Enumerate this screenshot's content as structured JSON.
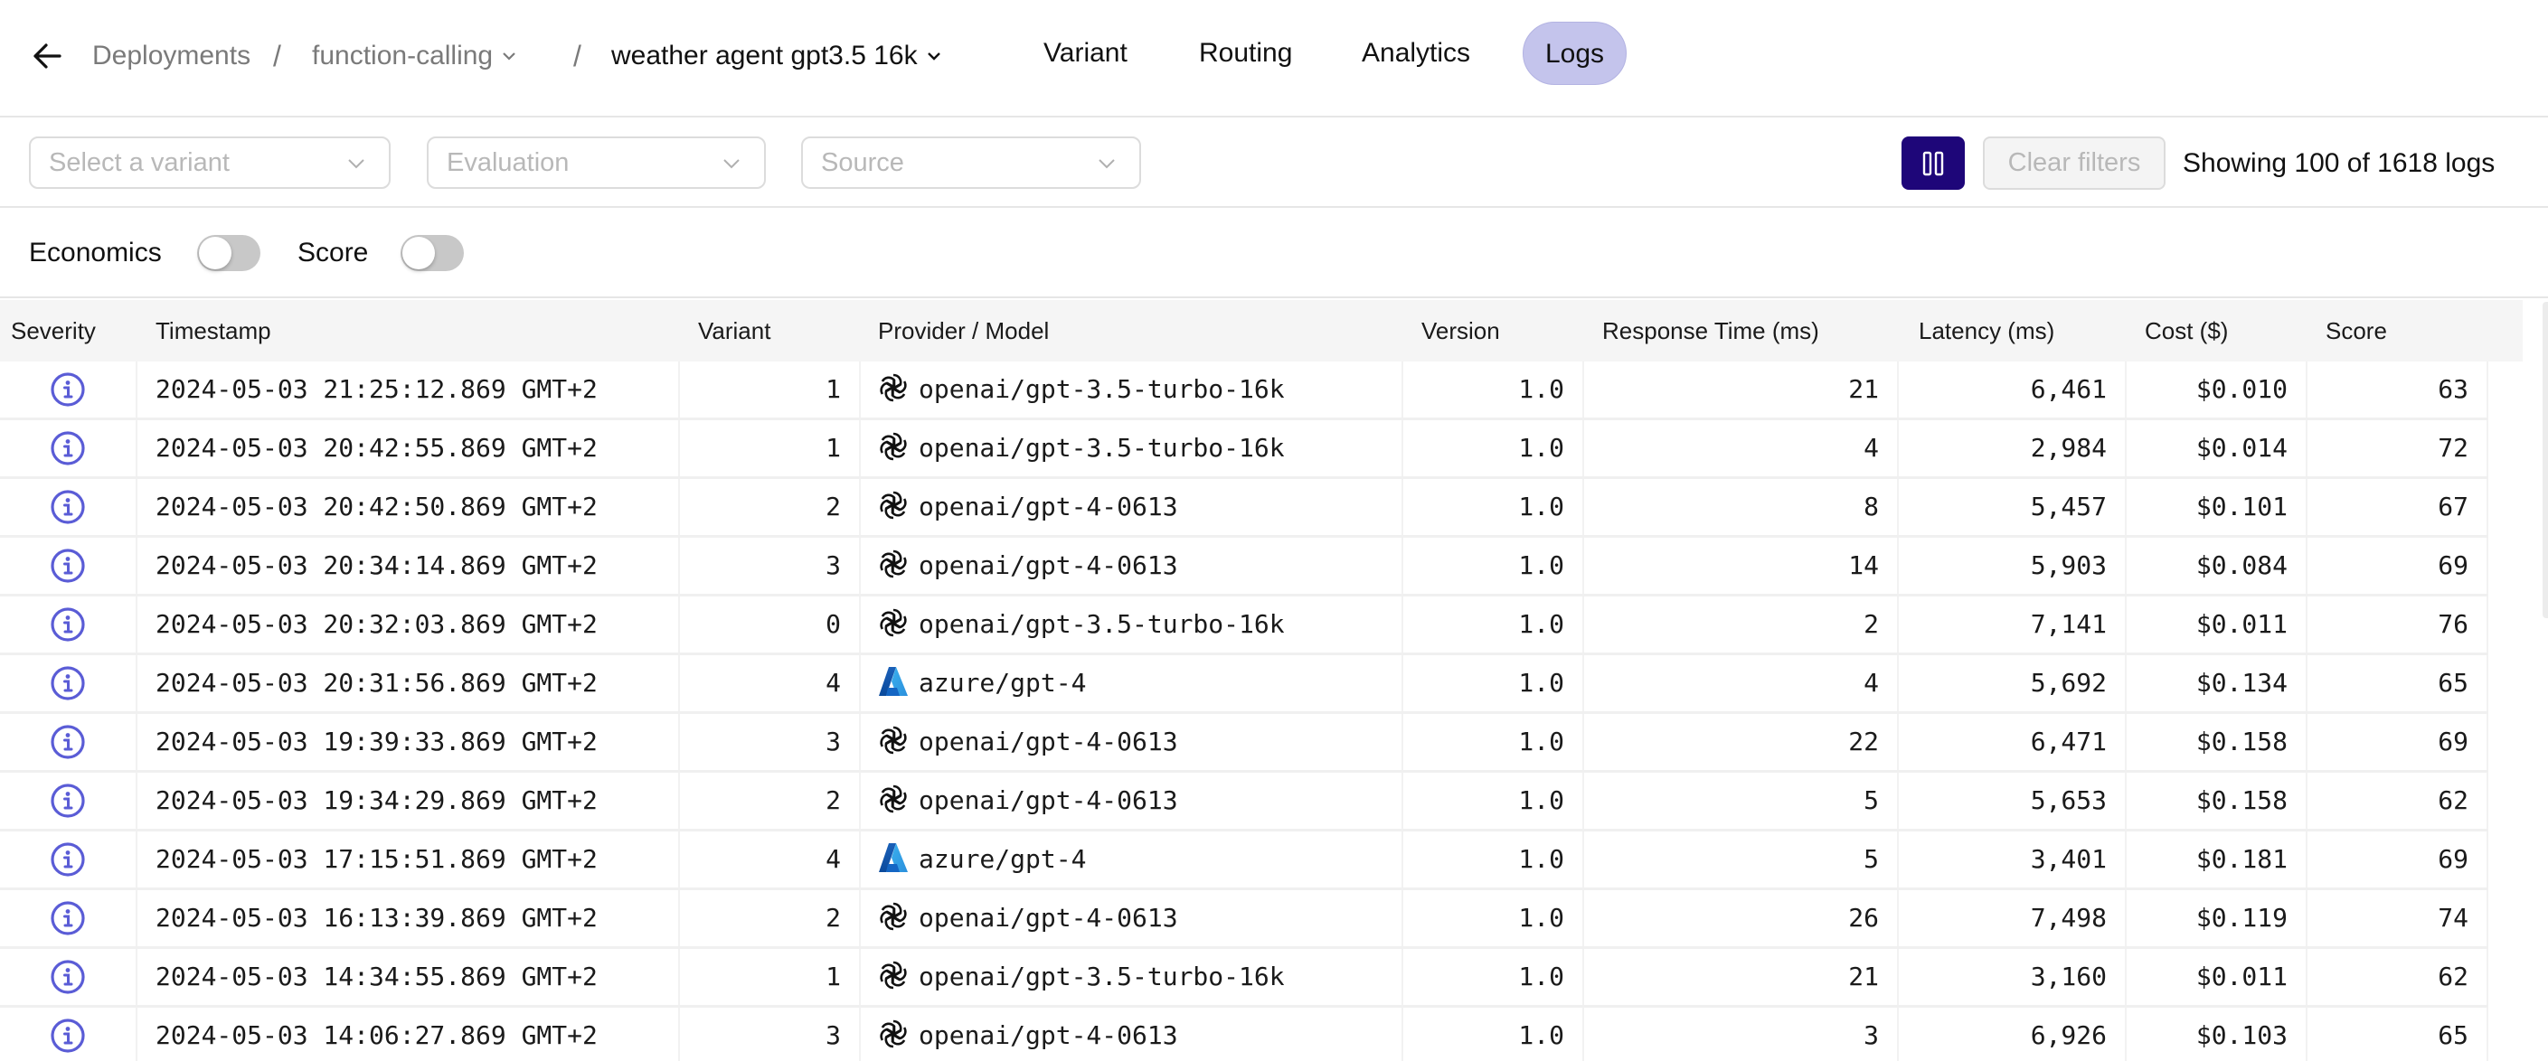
{
  "header": {
    "back_label": "Back",
    "breadcrumbs": [
      {
        "label": "Deployments",
        "has_dropdown": false
      },
      {
        "label": "function-calling",
        "has_dropdown": true
      },
      {
        "label": "weather agent gpt3.5 16k",
        "has_dropdown": true
      }
    ],
    "separator": "/",
    "tabs": [
      {
        "label": "Variant",
        "active": false
      },
      {
        "label": "Routing",
        "active": false
      },
      {
        "label": "Analytics",
        "active": false
      },
      {
        "label": "Logs",
        "active": true
      }
    ]
  },
  "filters": {
    "variant_placeholder": "Select a variant",
    "evaluation_placeholder": "Evaluation",
    "source_placeholder": "Source",
    "pause_icon": "pause-icon",
    "clear_label": "Clear filters",
    "showing_text": "Showing 100 of 1618 logs"
  },
  "toggles": [
    {
      "label": "Economics",
      "on": false
    },
    {
      "label": "Score",
      "on": false
    }
  ],
  "colors": {
    "accent": "#1e0679",
    "active_tab": "#c4c4ec",
    "info_icon": "#5a5cd6"
  },
  "table": {
    "columns": [
      "Severity",
      "Timestamp",
      "Variant",
      "Provider / Model",
      "Version",
      "Response Time (ms)",
      "Latency (ms)",
      "Cost ($)",
      "Score"
    ],
    "rows": [
      {
        "severity": "info",
        "timestamp": "2024-05-03 21:25:12.869 GMT+2",
        "variant": "1",
        "provider": "openai",
        "model": "openai/gpt-3.5-turbo-16k",
        "version": "1.0",
        "response_time": "21",
        "latency": "6,461",
        "cost": "$0.010",
        "score": "63"
      },
      {
        "severity": "info",
        "timestamp": "2024-05-03 20:42:55.869 GMT+2",
        "variant": "1",
        "provider": "openai",
        "model": "openai/gpt-3.5-turbo-16k",
        "version": "1.0",
        "response_time": "4",
        "latency": "2,984",
        "cost": "$0.014",
        "score": "72"
      },
      {
        "severity": "info",
        "timestamp": "2024-05-03 20:42:50.869 GMT+2",
        "variant": "2",
        "provider": "openai",
        "model": "openai/gpt-4-0613",
        "version": "1.0",
        "response_time": "8",
        "latency": "5,457",
        "cost": "$0.101",
        "score": "67"
      },
      {
        "severity": "info",
        "timestamp": "2024-05-03 20:34:14.869 GMT+2",
        "variant": "3",
        "provider": "openai",
        "model": "openai/gpt-4-0613",
        "version": "1.0",
        "response_time": "14",
        "latency": "5,903",
        "cost": "$0.084",
        "score": "69"
      },
      {
        "severity": "info",
        "timestamp": "2024-05-03 20:32:03.869 GMT+2",
        "variant": "0",
        "provider": "openai",
        "model": "openai/gpt-3.5-turbo-16k",
        "version": "1.0",
        "response_time": "2",
        "latency": "7,141",
        "cost": "$0.011",
        "score": "76"
      },
      {
        "severity": "info",
        "timestamp": "2024-05-03 20:31:56.869 GMT+2",
        "variant": "4",
        "provider": "azure",
        "model": "azure/gpt-4",
        "version": "1.0",
        "response_time": "4",
        "latency": "5,692",
        "cost": "$0.134",
        "score": "65"
      },
      {
        "severity": "info",
        "timestamp": "2024-05-03 19:39:33.869 GMT+2",
        "variant": "3",
        "provider": "openai",
        "model": "openai/gpt-4-0613",
        "version": "1.0",
        "response_time": "22",
        "latency": "6,471",
        "cost": "$0.158",
        "score": "69"
      },
      {
        "severity": "info",
        "timestamp": "2024-05-03 19:34:29.869 GMT+2",
        "variant": "2",
        "provider": "openai",
        "model": "openai/gpt-4-0613",
        "version": "1.0",
        "response_time": "5",
        "latency": "5,653",
        "cost": "$0.158",
        "score": "62"
      },
      {
        "severity": "info",
        "timestamp": "2024-05-03 17:15:51.869 GMT+2",
        "variant": "4",
        "provider": "azure",
        "model": "azure/gpt-4",
        "version": "1.0",
        "response_time": "5",
        "latency": "3,401",
        "cost": "$0.181",
        "score": "69"
      },
      {
        "severity": "info",
        "timestamp": "2024-05-03 16:13:39.869 GMT+2",
        "variant": "2",
        "provider": "openai",
        "model": "openai/gpt-4-0613",
        "version": "1.0",
        "response_time": "26",
        "latency": "7,498",
        "cost": "$0.119",
        "score": "74"
      },
      {
        "severity": "info",
        "timestamp": "2024-05-03 14:34:55.869 GMT+2",
        "variant": "1",
        "provider": "openai",
        "model": "openai/gpt-3.5-turbo-16k",
        "version": "1.0",
        "response_time": "21",
        "latency": "3,160",
        "cost": "$0.011",
        "score": "62"
      },
      {
        "severity": "info",
        "timestamp": "2024-05-03 14:06:27.869 GMT+2",
        "variant": "3",
        "provider": "openai",
        "model": "openai/gpt-4-0613",
        "version": "1.0",
        "response_time": "3",
        "latency": "6,926",
        "cost": "$0.103",
        "score": "65"
      }
    ]
  }
}
